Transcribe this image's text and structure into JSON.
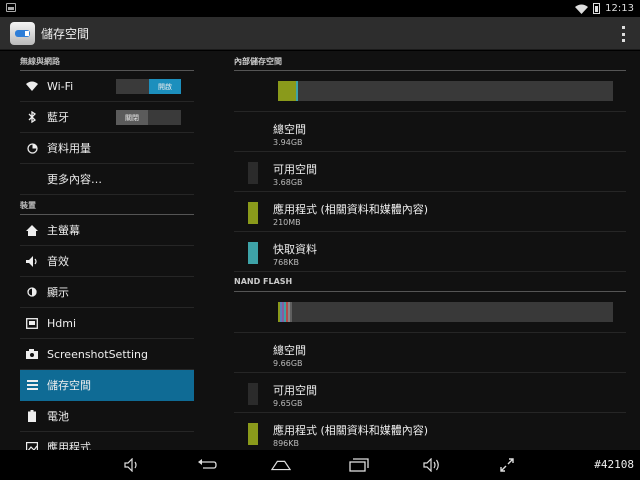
{
  "status_bar": {
    "time": "12:13",
    "icons": [
      "notification-icon",
      "wifi-icon",
      "battery-icon"
    ]
  },
  "action_bar": {
    "title": "儲存空間",
    "icon": "storage-app-icon",
    "overflow_icon": "overflow-menu-icon"
  },
  "sidebar": {
    "sections": [
      {
        "header": "無線與網路",
        "items": [
          {
            "label": "Wi-Fi",
            "icon": "wifi-icon",
            "switch": {
              "state": "on",
              "label": "開啟"
            }
          },
          {
            "label": "藍牙",
            "icon": "bluetooth-icon",
            "switch": {
              "state": "off",
              "label": "關閉"
            }
          },
          {
            "label": "資料用量",
            "icon": "data-usage-icon"
          },
          {
            "label": "更多內容…",
            "icon": ""
          }
        ]
      },
      {
        "header": "裝置",
        "items": [
          {
            "label": "主螢幕",
            "icon": "home-icon"
          },
          {
            "label": "音效",
            "icon": "volume-icon"
          },
          {
            "label": "顯示",
            "icon": "display-icon"
          },
          {
            "label": "Hdmi",
            "icon": "hdmi-icon"
          },
          {
            "label": "ScreenshotSetting",
            "icon": "camera-icon"
          },
          {
            "label": "儲存空間",
            "icon": "storage-icon",
            "selected": true
          },
          {
            "label": "電池",
            "icon": "battery-icon"
          },
          {
            "label": "應用程式",
            "icon": "apps-icon"
          }
        ]
      }
    ]
  },
  "storage": {
    "volumes": [
      {
        "header": "內部儲存空間",
        "bar_segments": [
          {
            "name": "應用程式",
            "fraction": 0.053,
            "color": "#8a9a1b"
          },
          {
            "name": "快取資料",
            "fraction": 0.008,
            "color": "#3ea3a8"
          }
        ],
        "stats": [
          {
            "name": "總空間",
            "value": "3.94GB",
            "color": ""
          },
          {
            "name": "可用空間",
            "value": "3.68GB",
            "color": "#2b2b2b"
          },
          {
            "name": "應用程式 (相關資料和媒體內容)",
            "value": "210MB",
            "color": "#8a9a1b"
          },
          {
            "name": "快取資料",
            "value": "768KB",
            "color": "#3ea3a8"
          }
        ]
      },
      {
        "header": "NAND FLASH",
        "bar_segments": [
          {
            "name": "應用程式",
            "fraction": 0.006,
            "color": "#8a9a1b"
          },
          {
            "name": "seg2",
            "fraction": 0.006,
            "color": "#5a7fb5"
          },
          {
            "name": "seg3",
            "fraction": 0.006,
            "color": "#8b5a9e"
          },
          {
            "name": "seg4",
            "fraction": 0.006,
            "color": "#3ea3a8"
          },
          {
            "name": "seg5",
            "fraction": 0.006,
            "color": "#b54a4a"
          },
          {
            "name": "seg6",
            "fraction": 0.006,
            "color": "#8a8a8a"
          },
          {
            "name": "seg7",
            "fraction": 0.006,
            "color": "#5f5f5f"
          }
        ],
        "stats": [
          {
            "name": "總空間",
            "value": "9.66GB",
            "color": ""
          },
          {
            "name": "可用空間",
            "value": "9.65GB",
            "color": "#2b2b2b"
          },
          {
            "name": "應用程式 (相關資料和媒體內容)",
            "value": "896KB",
            "color": "#8a9a1b"
          }
        ]
      }
    ]
  },
  "nav_bar": {
    "buttons": [
      "volume-down-icon",
      "back-icon",
      "home-icon",
      "recents-icon",
      "volume-up-icon",
      "fullscreen-icon"
    ],
    "watermark": "#42108"
  }
}
